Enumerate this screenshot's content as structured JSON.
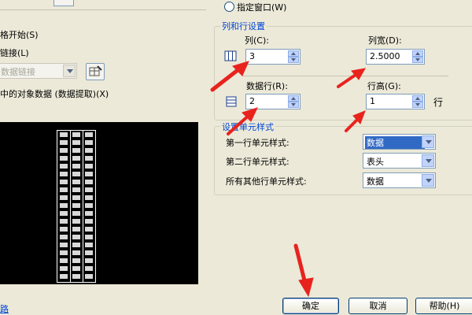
{
  "left_options": {
    "start_from_empty": "格开始(S)",
    "link": "链接(L)",
    "data_link_select": "数据链接",
    "object_data": "中的对象数据 (数据提取)(X)"
  },
  "insert_options": {
    "specify_window": "指定窗口(W)"
  },
  "columns_rows": {
    "title": "列和行设置",
    "columns_label": "列(C):",
    "columns_value": "3",
    "col_width_label": "列宽(D):",
    "col_width_value": "2.5000",
    "data_rows_label": "数据行(R):",
    "data_rows_value": "2",
    "row_height_label": "行高(G):",
    "row_height_value": "1",
    "row_unit": "行"
  },
  "cell_styles": {
    "title": "设置单元样式",
    "first_row_label": "第一行单元样式:",
    "first_row_value": "数据",
    "second_row_label": "第二行单元样式:",
    "second_row_value": "表头",
    "other_rows_label": "所有其他行单元样式:",
    "other_rows_value": "数据"
  },
  "buttons": {
    "ok": "确定",
    "cancel": "取消",
    "help": "帮助(H)"
  },
  "link_text": "路",
  "colors": {
    "dialog_bg": "#ece9d8",
    "group_title": "#0046d5",
    "selection": "#316ac5",
    "annotation_arrow": "#e8231e"
  }
}
